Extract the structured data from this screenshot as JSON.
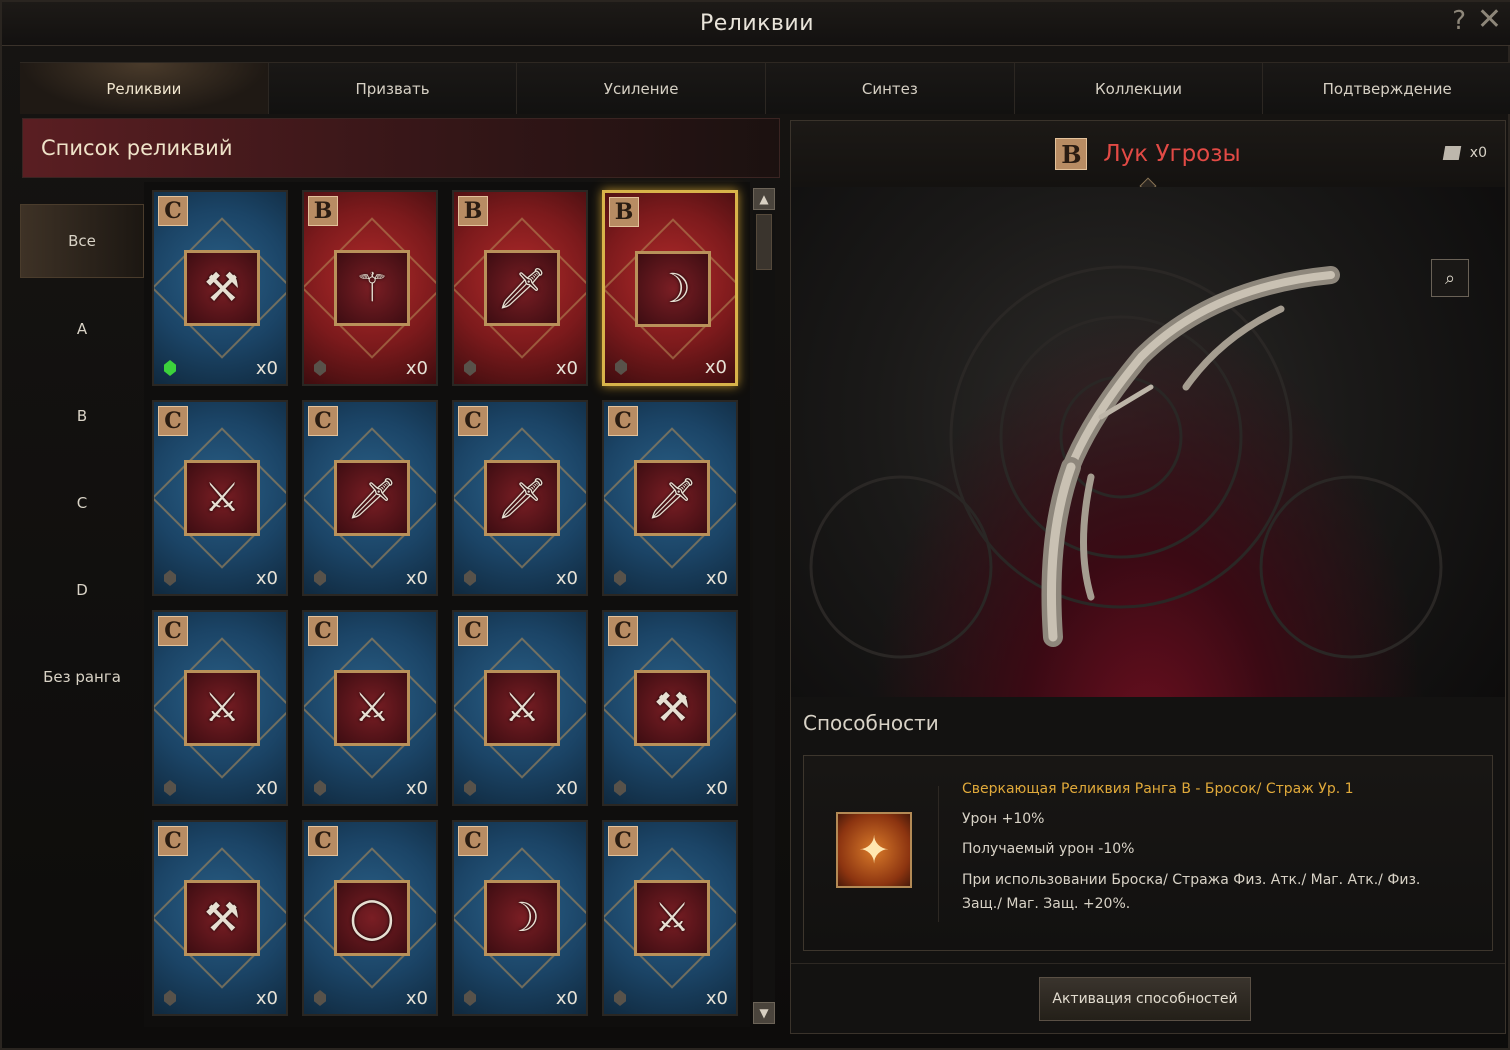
{
  "window": {
    "title": "Реликвии",
    "help": "?",
    "close": "✕"
  },
  "tabs": [
    {
      "label": "Реликвии",
      "active": true
    },
    {
      "label": "Призвать"
    },
    {
      "label": "Усиление"
    },
    {
      "label": "Синтез"
    },
    {
      "label": "Коллекции"
    },
    {
      "label": "Подтверждение"
    }
  ],
  "list": {
    "title": "Список реликвий"
  },
  "filters": [
    {
      "label": "Все",
      "active": true
    },
    {
      "label": "A"
    },
    {
      "label": "B"
    },
    {
      "label": "C"
    },
    {
      "label": "D"
    },
    {
      "label": "Без ранга"
    }
  ],
  "cards": [
    {
      "rank": "C",
      "icon": "mace-icon",
      "glyph": "⚒",
      "count": "x0",
      "gem_active": true
    },
    {
      "rank": "B",
      "icon": "staff-icon",
      "glyph": "⚚",
      "count": "x0"
    },
    {
      "rank": "B",
      "icon": "dagger-icon",
      "glyph": "🗡",
      "count": "x0"
    },
    {
      "rank": "B",
      "icon": "bow-icon",
      "glyph": "☽",
      "count": "x0",
      "selected": true
    },
    {
      "rank": "C",
      "icon": "axe-icon",
      "glyph": "⚔",
      "count": "x0"
    },
    {
      "rank": "C",
      "icon": "sword-icon",
      "glyph": "🗡",
      "count": "x0"
    },
    {
      "rank": "C",
      "icon": "dagger-icon",
      "glyph": "🗡",
      "count": "x0"
    },
    {
      "rank": "C",
      "icon": "sword-icon",
      "glyph": "🗡",
      "count": "x0"
    },
    {
      "rank": "C",
      "icon": "crossed-swords-icon",
      "glyph": "⚔",
      "count": "x0"
    },
    {
      "rank": "C",
      "icon": "crossed-swords-icon",
      "glyph": "⚔",
      "count": "x0"
    },
    {
      "rank": "C",
      "icon": "crossed-swords-icon",
      "glyph": "⚔",
      "count": "x0"
    },
    {
      "rank": "C",
      "icon": "axe-icon",
      "glyph": "⚒",
      "count": "x0"
    },
    {
      "rank": "C",
      "icon": "mace-icon",
      "glyph": "⚒",
      "count": "x0"
    },
    {
      "rank": "C",
      "icon": "ring-icon",
      "glyph": "◯",
      "count": "x0"
    },
    {
      "rank": "C",
      "icon": "bow-icon",
      "glyph": "☽",
      "count": "x0"
    },
    {
      "rank": "C",
      "icon": "axe-icon",
      "glyph": "⚔",
      "count": "x0"
    }
  ],
  "detail": {
    "rank": "B",
    "name": "Лук Угрозы",
    "owned": "x0",
    "abilities_title": "Способности",
    "ability": {
      "name": "Сверкающая Реликвия Ранга B - Бросок/ Страж Ур. 1",
      "line1": "Урон +10%",
      "line2": "Получаемый урон -10%",
      "line3": "При использовании Броска/ Стража Физ. Атк./ Маг. Атк./ Физ. Защ./ Маг. Защ. +20%."
    },
    "activate_label": "Активация способностей"
  },
  "colors": {
    "rank_b_bg": "#7c1a1c",
    "rank_c_bg": "#1b4466",
    "selected_border": "#d8b34a",
    "item_name": "#e24a45",
    "ability_name": "#e0a93a"
  }
}
